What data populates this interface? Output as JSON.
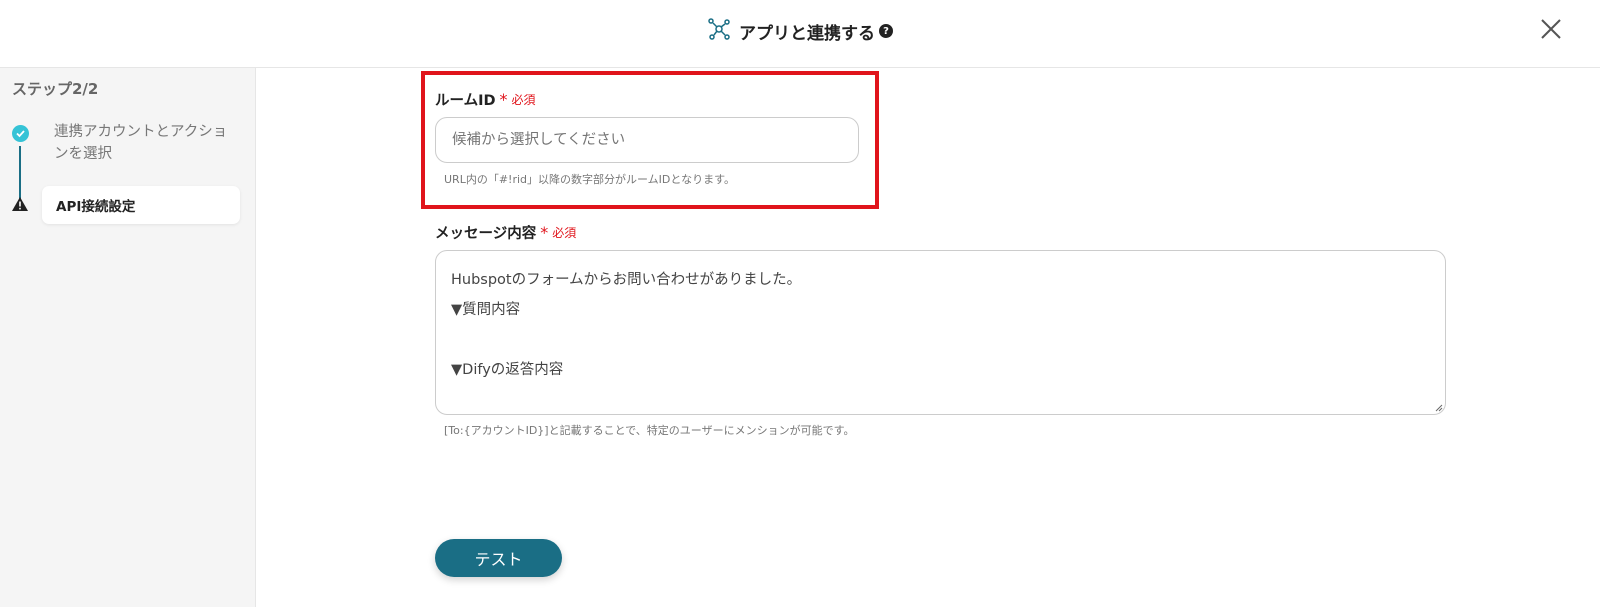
{
  "header": {
    "title": "アプリと連携する",
    "help_symbol": "?",
    "icon": "network-icon",
    "close_icon": "close-icon"
  },
  "sidebar": {
    "step_label": "ステップ2/2",
    "steps": [
      {
        "label": "連携アカウントとアクションを選択",
        "status": "completed",
        "icon": "check-icon"
      },
      {
        "label": "API接続設定",
        "status": "current-warning",
        "icon": "warning-icon"
      }
    ]
  },
  "form": {
    "room_id": {
      "label": "ルームID",
      "required_star": "*",
      "required_text": "必須",
      "placeholder": "候補から選択してください",
      "hint": "URL内の「#!rid」以降の数字部分がルームIDとなります。"
    },
    "message": {
      "label": "メッセージ内容",
      "required_star": "*",
      "required_text": "必須",
      "lines": [
        "Hubspotのフォームからお問い合わせがありました。",
        "▼質問内容",
        "",
        "▼Difyの返答内容"
      ],
      "hint": "[To:{アカウントID}]と記載することで、特定のユーザーにメンションが可能です。"
    }
  },
  "actions": {
    "test_label": "テスト"
  },
  "colors": {
    "accent": "#1a6e85",
    "check": "#35c3d6",
    "required": "#e0141b",
    "highlight_border": "#e0141b"
  }
}
